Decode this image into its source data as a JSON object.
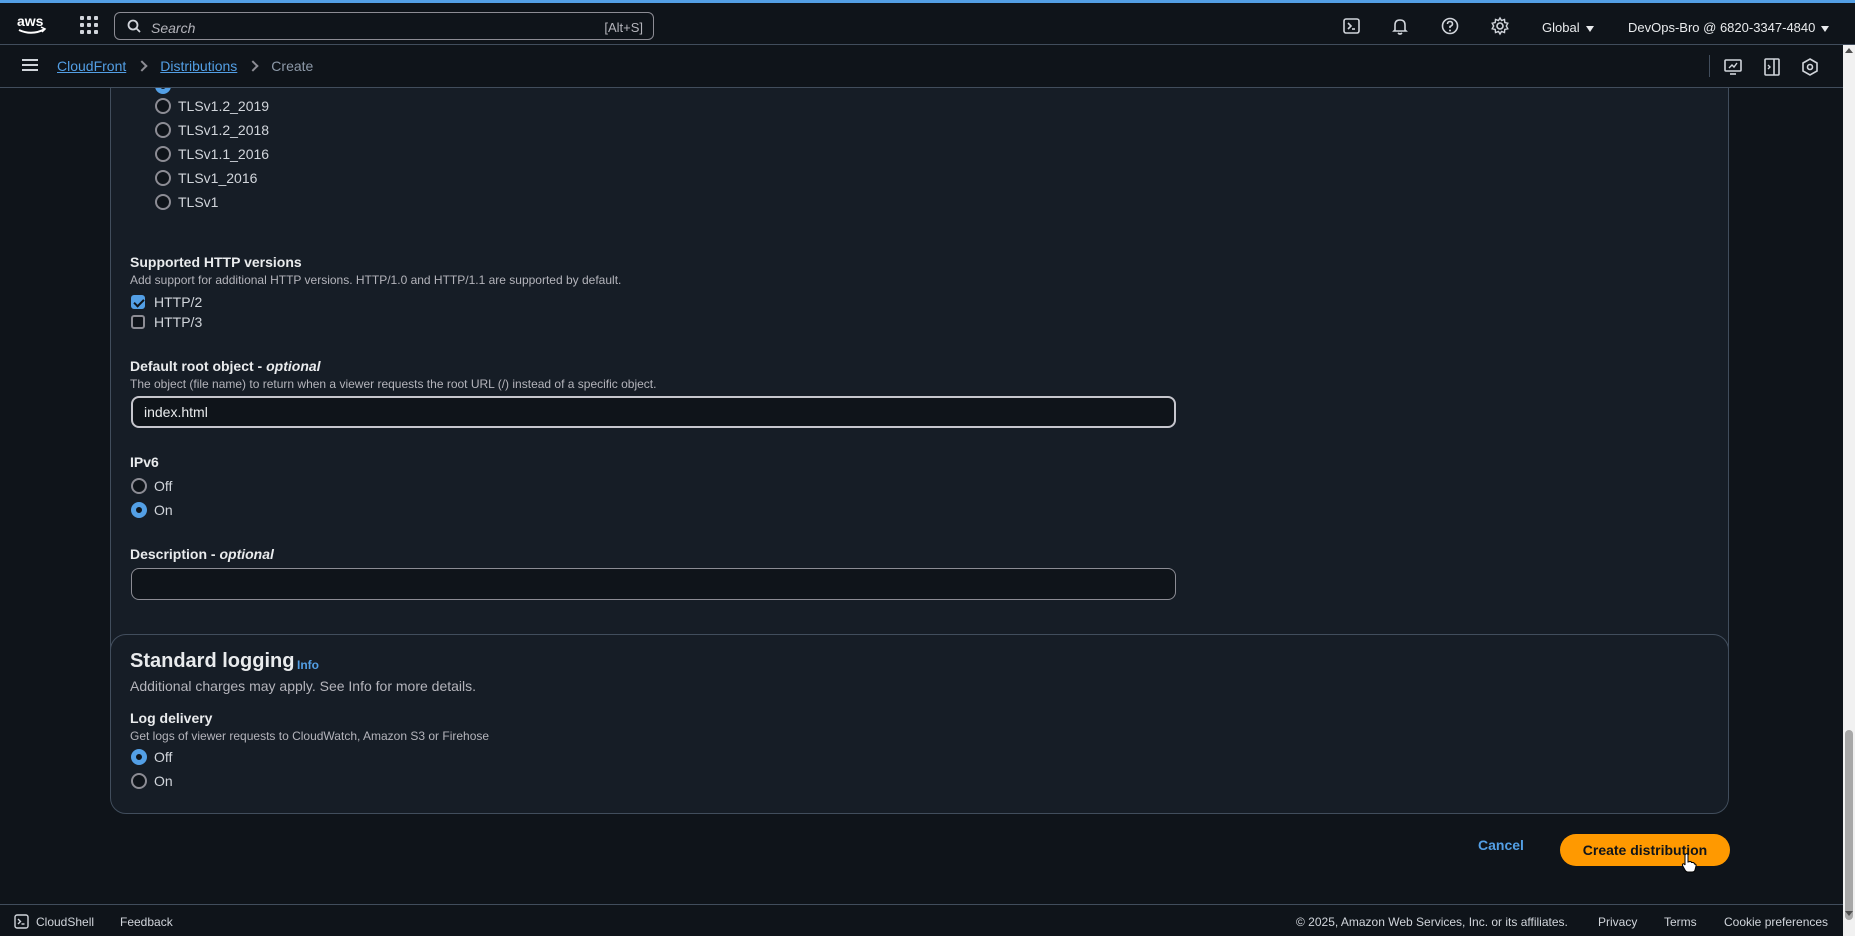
{
  "topnav": {
    "logo": "aws",
    "search_placeholder": "Search",
    "search_shortcut": "[Alt+S]",
    "region": "Global",
    "account": "DevOps-Bro @ 6820-3347-4840",
    "icons": [
      "cloudshell-icon",
      "bell-icon",
      "help-icon",
      "gear-icon"
    ]
  },
  "breadcrumb": {
    "items": [
      "CloudFront",
      "Distributions"
    ],
    "current": "Create"
  },
  "security_policy": {
    "options": [
      "TLSv1.2_2019",
      "TLSv1.2_2018",
      "TLSv1.1_2016",
      "TLSv1_2016",
      "TLSv1"
    ]
  },
  "http_versions": {
    "label": "Supported HTTP versions",
    "description": "Add support for additional HTTP versions. HTTP/1.0 and HTTP/1.1 are supported by default.",
    "options": [
      {
        "label": "HTTP/2",
        "checked": true
      },
      {
        "label": "HTTP/3",
        "checked": false
      }
    ]
  },
  "root_object": {
    "label": "Default root object - ",
    "optional": "optional",
    "description": "The object (file name) to return when a viewer requests the root URL (/) instead of a specific object.",
    "value": "index.html"
  },
  "ipv6": {
    "label": "IPv6",
    "options": [
      {
        "label": "Off",
        "checked": false
      },
      {
        "label": "On",
        "checked": true
      }
    ]
  },
  "description_field": {
    "label": "Description - ",
    "optional": "optional",
    "value": ""
  },
  "logging": {
    "title": "Standard logging",
    "info": "Info",
    "description": "Additional charges may apply. See Info for more details.",
    "delivery_label": "Log delivery",
    "delivery_description": "Get logs of viewer requests to CloudWatch, Amazon S3 or Firehose",
    "options": [
      {
        "label": "Off",
        "checked": true
      },
      {
        "label": "On",
        "checked": false
      }
    ]
  },
  "actions": {
    "cancel": "Cancel",
    "create": "Create distribution"
  },
  "footer": {
    "cloudshell": "CloudShell",
    "feedback": "Feedback",
    "copyright": "© 2025, Amazon Web Services, Inc. or its affiliates.",
    "privacy": "Privacy",
    "terms": "Terms",
    "cookies": "Cookie preferences"
  },
  "colors": {
    "accent": "#539fe5",
    "primary_button": "#ff9900",
    "background": "#0f141a"
  }
}
